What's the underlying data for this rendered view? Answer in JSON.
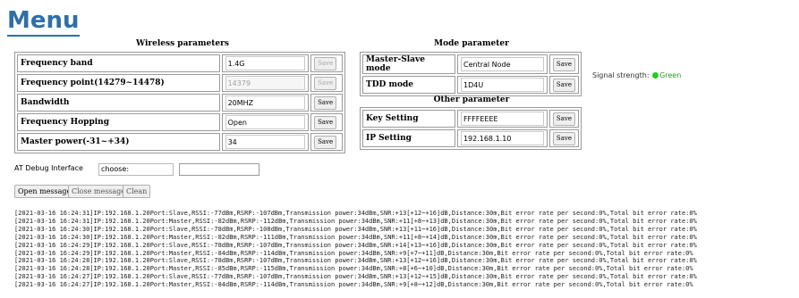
{
  "page": {
    "title": "Menu"
  },
  "wireless": {
    "caption": "Wireless parameters",
    "rows": [
      {
        "label": "Frequency band",
        "value": "1.4G",
        "save": "Save"
      },
      {
        "label": "Frequency point(14279~14478)",
        "value": "14379",
        "save": "Save"
      },
      {
        "label": "Bandwidth",
        "value": "20MHZ",
        "save": "Save"
      },
      {
        "label": "Frequency Hopping",
        "value": "Open",
        "save": "Save"
      },
      {
        "label": "Master power(-31~+34)",
        "value": "34",
        "save": "Save"
      }
    ]
  },
  "mode": {
    "caption": "Mode parameter",
    "rows": [
      {
        "label": "Master-Slave mode",
        "value": "Central Node",
        "save": "Save"
      },
      {
        "label": "TDD mode",
        "value": "1D4U",
        "save": "Save"
      }
    ]
  },
  "other": {
    "caption": "Other parameter",
    "rows": [
      {
        "label": "Key Setting",
        "value": "FFFFEEEE",
        "save": "Save"
      },
      {
        "label": "IP Setting",
        "value": "192.168.1.10",
        "save": "Save"
      }
    ]
  },
  "signal": {
    "label": "Signal strength:",
    "status": "Green",
    "color": "#22cc22"
  },
  "at_debug": {
    "label": "AT Debug Interface",
    "selected": "choose:",
    "input_value": ""
  },
  "buttons": {
    "open": "Open message",
    "close": "Close message",
    "clean": "Clean"
  },
  "log_lines": [
    "[2021-03-16 16:24:31]IP:192.168.1.20Port:Slave,RSSI:-77dBm,RSRP:-107dBm,Transmission power:34dBm,SNR:+13[+12~+16]dB,Distance:30m,Bit error rate per second:0%,Total bit error rate:0%",
    "[2021-03-16 16:24:31]IP:192.168.1.20Port:Master,RSSI:-82dBm,RSRP:-112dBm,Transmission power:34dBm,SNR:+11[+8~+13]dB,Distance:30m,Bit error rate per second:0%,Total bit error rate:0%",
    "[2021-03-16 16:24:30]IP:192.168.1.20Port:Slave,RSSI:-78dBm,RSRP:-108dBm,Transmission power:34dBm,SNR:+13[+11~+16]dB,Distance:30m,Bit error rate per second:0%,Total bit error rate:0%",
    "[2021-03-16 16:24:30]IP:192.168.1.20Port:Master,RSSI:-82dBm,RSRP:-111dBm,Transmission power:34dBm,SNR:+11[+8~+14]dB,Distance:30m,Bit error rate per second:0%,Total bit error rate:0%",
    "[2021-03-16 16:24:29]IP:192.168.1.20Port:Slave,RSSI:-78dBm,RSRP:-107dBm,Transmission power:34dBm,SNR:+14[+13~+16]dB,Distance:30m,Bit error rate per second:0%,Total bit error rate:0%",
    "[2021-03-16 16:24:29]IP:192.168.1.20Port:Master,RSSI:-84dBm,RSRP:-114dBm,Transmission power:34dBm,SNR:+9[+7~+11]dB,Distance:30m,Bit error rate per second:0%,Total bit error rate:0%",
    "[2021-03-16 16:24:28]IP:192.168.1.20Port:Slave,RSSI:-78dBm,RSRP:-107dBm,Transmission power:34dBm,SNR:+13[+12~+16]dB,Distance:30m,Bit error rate per second:0%,Total bit error rate:0%",
    "[2021-03-16 16:24:28]IP:192.168.1.20Port:Master,RSSI:-85dBm,RSRP:-115dBm,Transmission power:34dBm,SNR:+8[+6~+10]dB,Distance:30m,Bit error rate per second:0%,Total bit error rate:0%",
    "[2021-03-16 16:24:27]IP:192.168.1.20Port:Slave,RSSI:-77dBm,RSRP:-107dBm,Transmission power:34dBm,SNR:+13[+12~+15]dB,Distance:30m,Bit error rate per second:0%,Total bit error rate:0%",
    "[2021-03-16 16:24:27]IP:192.168.1.20Port:Master,RSSI:-84dBm,RSRP:-114dBm,Transmission power:34dBm,SNR:+9[+8~+12]dB,Distance:30m,Bit error rate per second:0%,Total bit error rate:0%"
  ]
}
